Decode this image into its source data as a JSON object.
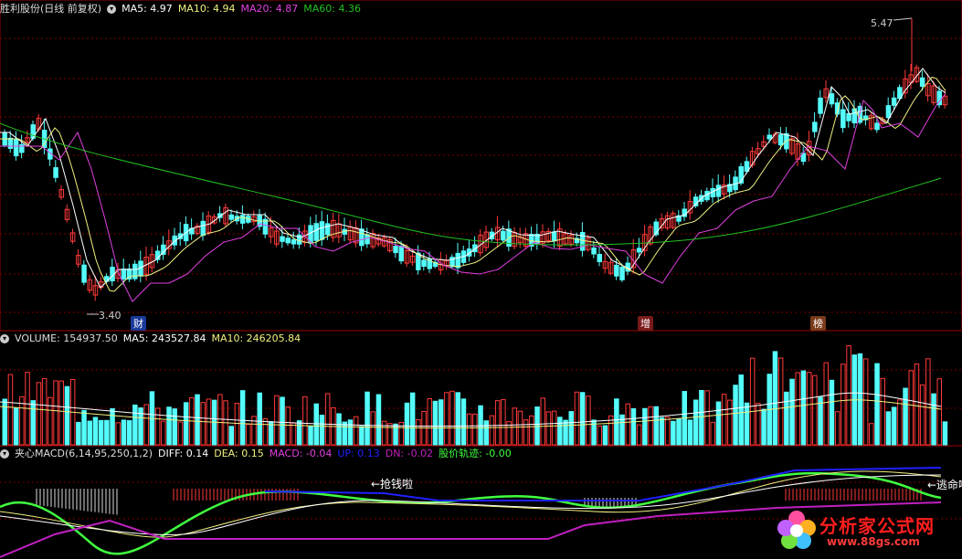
{
  "price_header": {
    "stock_name": "胜利股份(日线 前复权)",
    "ma5": "MA5: 4.97",
    "ma10": "MA10: 4.94",
    "ma20": "MA20: 4.87",
    "ma60": "MA60: 4.36"
  },
  "price_annotations": {
    "high": "5.47",
    "low": "3.40"
  },
  "events": [
    "财",
    "增",
    "榜"
  ],
  "volume_header": {
    "volume": "VOLUME: 154937.50",
    "ma5": "MA5: 243527.84",
    "ma10": "MA10: 246205.84"
  },
  "macd_header": {
    "name": "夹心MACD(6,14,95,250,1,2)",
    "diff": "DIFF: 0.14",
    "dea": "DEA: 0.15",
    "macd": "MACD: -0.04",
    "up": "UP: 0.13",
    "dn": "DN: -0.02",
    "track": "股价轨迹: -0.00"
  },
  "macd_annotations": {
    "grab": "←抢钱啦",
    "escape": "←逃命啦"
  },
  "logo": {
    "title": "分析家公式网",
    "url": "www.88gs.com"
  },
  "colors": {
    "up": "#ff3a3a",
    "down": "#54fcfc",
    "ma5": "#ffffff",
    "ma10": "#f0f080",
    "ma20": "#e040e0",
    "ma60": "#20c020",
    "diff": "#40ff40",
    "dea": "#2020ff",
    "purple": "#c020c0",
    "grid": "#8b0000"
  }
}
